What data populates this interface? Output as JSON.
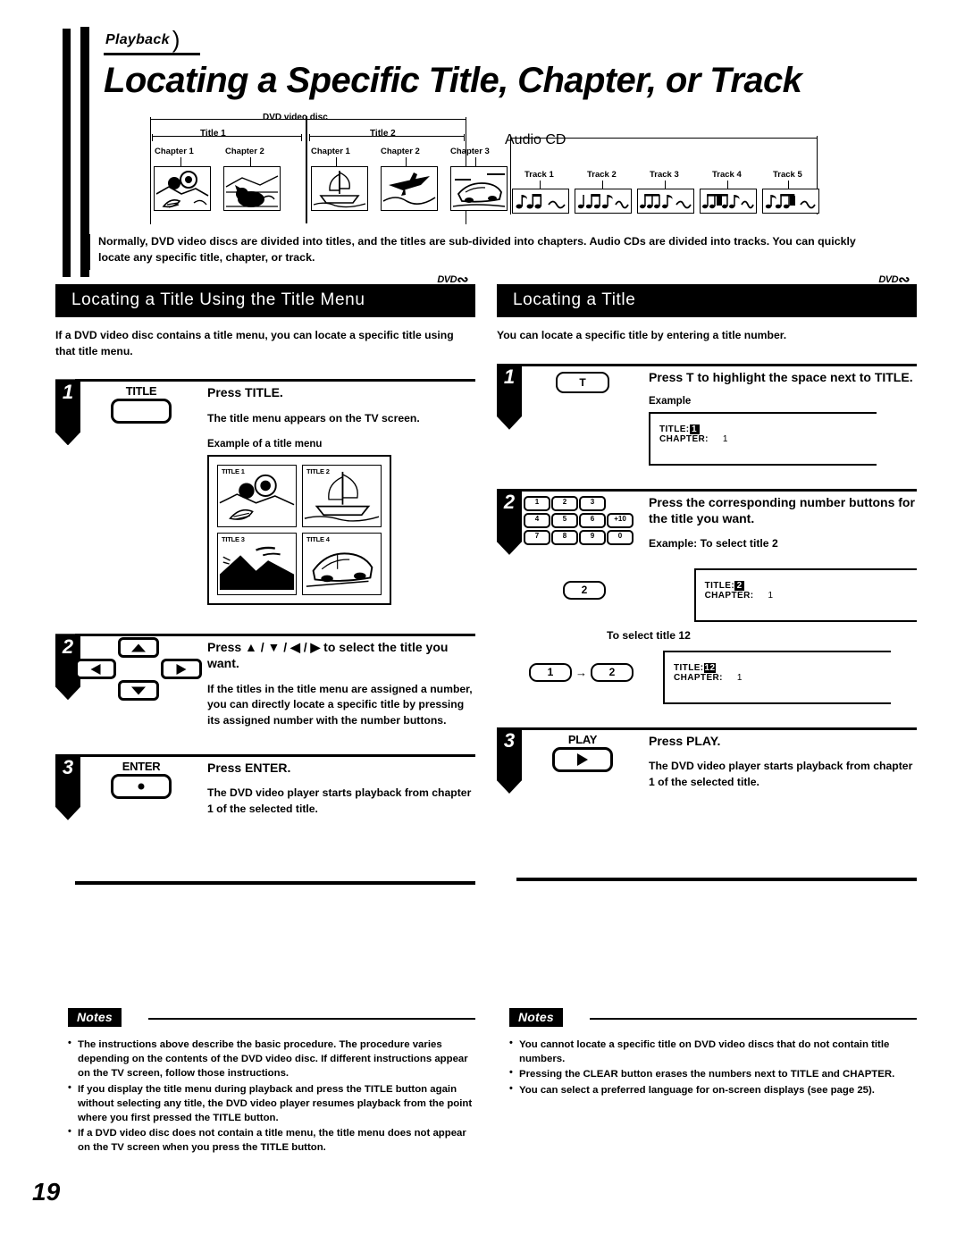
{
  "header": {
    "tab_label": "Playback",
    "title": "Locating a Specific Title, Chapter, or Track"
  },
  "diagram": {
    "dvd": {
      "span_label": "DVD video disc",
      "titles": [
        {
          "label": "Title 1",
          "chapters": [
            "Chapter 1",
            "Chapter 2"
          ]
        },
        {
          "label": "Title 2",
          "chapters": [
            "Chapter 1",
            "Chapter 2",
            "Chapter 3"
          ]
        }
      ]
    },
    "cd": {
      "span_label": "Audio CD",
      "tracks": [
        "Track 1",
        "Track 2",
        "Track 3",
        "Track 4",
        "Track 5"
      ]
    }
  },
  "intro": "Normally, DVD video discs are divided into titles, and the titles are sub-divided into chapters. Audio CDs are divided into tracks. You can quickly locate any specific title, chapter, or track.",
  "left_section": {
    "heading": "Locating a Title Using the Title Menu",
    "badge": "DVD",
    "intro": "If a DVD video disc contains a title menu, you can locate a specific title using that title menu.",
    "steps": [
      {
        "number": "1",
        "key_label": "TITLE",
        "title": "Press TITLE.",
        "desc": "The title menu appears on the TV screen.",
        "example_caption": "Example of a title menu",
        "menu_items": [
          "TITLE 1",
          "TITLE 2",
          "TITLE 3",
          "TITLE 4"
        ]
      },
      {
        "number": "2",
        "title": "Press ▲ / ▼ / ◀ / ▶ to select the title you want.",
        "desc": "If the titles in the title menu are assigned a number, you can directly locate a specific title by pressing its assigned number with the number buttons."
      },
      {
        "number": "3",
        "key_label": "ENTER",
        "title": "Press ENTER.",
        "desc": "The DVD video player starts playback from chapter 1 of the selected title."
      }
    ]
  },
  "right_section": {
    "heading": "Locating a Title",
    "badge": "DVD",
    "intro": "You can locate a specific title by entering a title number.",
    "steps": [
      {
        "number": "1",
        "key_label": "T",
        "title": "Press T to highlight the space next to TITLE.",
        "example_caption": "Example",
        "osd": {
          "title_label": "TITLE:",
          "title_value": "1",
          "chapter_label": "CHAPTER:",
          "chapter_value": "1"
        }
      },
      {
        "number": "2",
        "title": "Press the corresponding number buttons for the title you want.",
        "example_caption": "Example: To select title 2",
        "numpad": [
          "1",
          "2",
          "3",
          "4",
          "5",
          "6",
          "+10",
          "7",
          "8",
          "9",
          "0"
        ],
        "case_a": {
          "keys": [
            "2"
          ],
          "osd": {
            "title_label": "TITLE:",
            "title_value": "2",
            "chapter_label": "CHAPTER:",
            "chapter_value": "1"
          }
        },
        "mid_caption": "To select title 12",
        "case_b": {
          "keys": [
            "1",
            "2"
          ],
          "osd": {
            "title_label": "TITLE:",
            "title_value": "12",
            "chapter_label": "CHAPTER:",
            "chapter_value": "1"
          }
        }
      },
      {
        "number": "3",
        "key_label": "PLAY",
        "title": "Press PLAY.",
        "desc": "The DVD video player starts playback from chapter 1 of the selected title."
      }
    ]
  },
  "notes_left": {
    "tag": "Notes",
    "items": [
      "The instructions above describe the basic procedure. The procedure varies depending on the contents of the DVD video disc. If different instructions appear on the TV screen, follow those instructions.",
      "If you display the title menu during playback and press the TITLE button again without selecting any title, the DVD video player resumes playback from the point where you first pressed the TITLE button.",
      "If a DVD video disc does not contain a title menu, the title menu does not appear on the TV screen when you press the TITLE button."
    ]
  },
  "notes_right": {
    "tag": "Notes",
    "items": [
      "You cannot locate a specific title on DVD video discs that do not contain title numbers.",
      "Pressing the CLEAR button erases the numbers next to TITLE and CHAPTER.",
      "You can select a preferred language for on-screen displays (see page 25)."
    ]
  },
  "page_number": "19"
}
